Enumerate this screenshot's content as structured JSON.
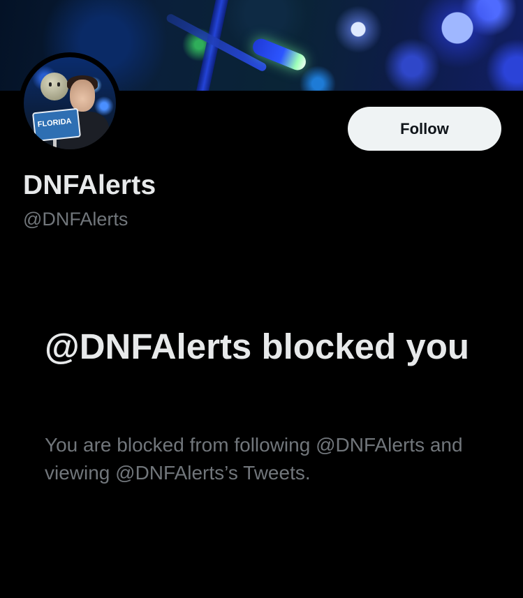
{
  "profile": {
    "display_name": "DNFAlerts",
    "handle": "@DNFAlerts",
    "follow_label": "Follow",
    "avatar_sign_text": "FLORIDA"
  },
  "blocked": {
    "title": "@DNFAlerts blocked you",
    "description": "You are blocked from following @DNFAlerts and viewing @DNFAlerts’s Tweets."
  },
  "colors": {
    "background": "#000000",
    "primary_text": "#e7e9ea",
    "secondary_text": "#71767b",
    "button_bg": "#eff3f4"
  }
}
